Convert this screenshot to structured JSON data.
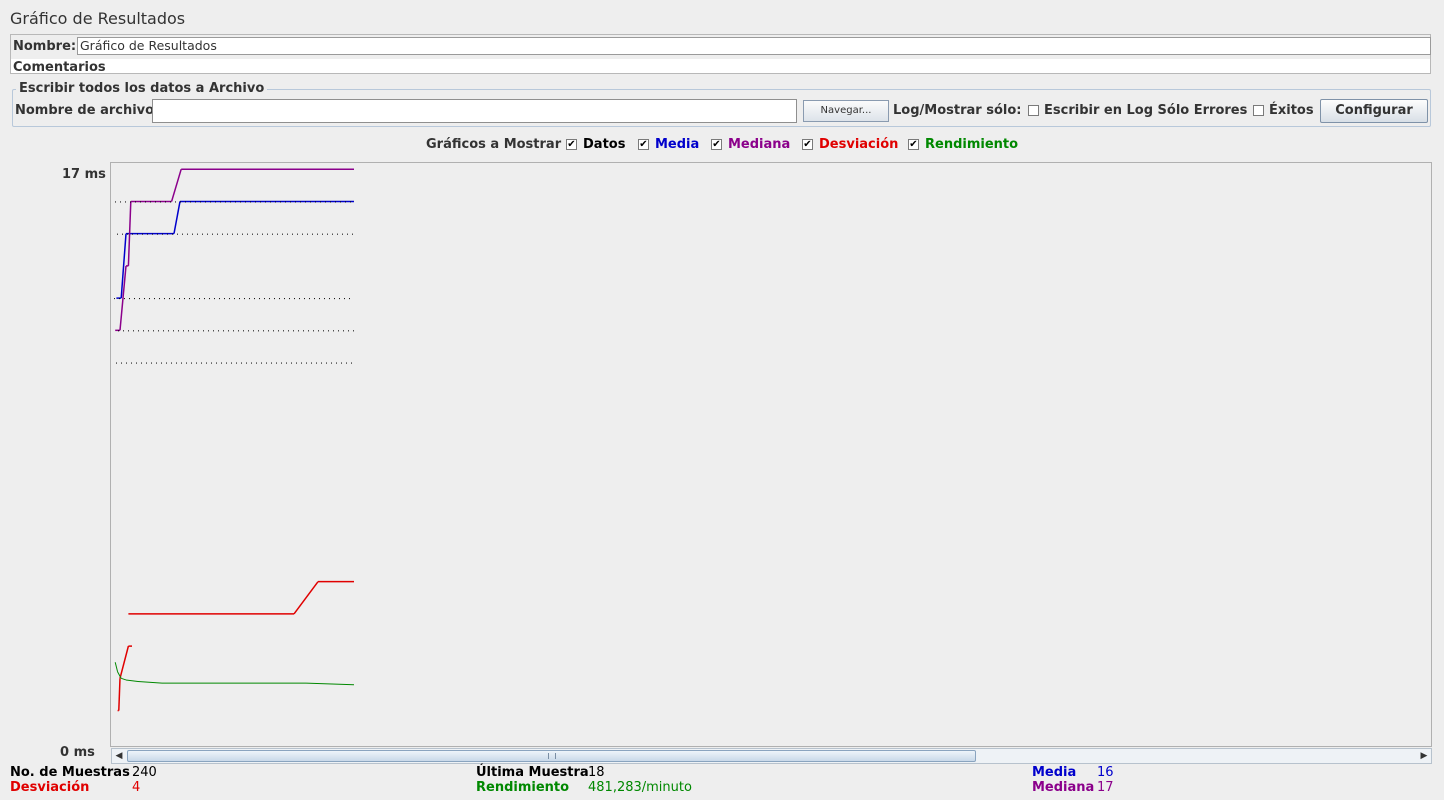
{
  "window": {
    "title": "Gráfico de Resultados"
  },
  "name_panel": {
    "name_label": "Nombre:",
    "name_value": "Gráfico de Resultados",
    "comments_label": "Comentarios"
  },
  "file_panel": {
    "group_title": "Escribir todos los datos a Archivo",
    "filename_label": "Nombre de archivo",
    "filename_value": "",
    "browse_label": "Navegar...",
    "log_show_label": "Log/Mostrar sólo:",
    "errors_only_label": "Escribir en Log Sólo Errores",
    "errors_only_checked": false,
    "successes_label": "Éxitos",
    "successes_checked": false,
    "configure_label": "Configurar"
  },
  "graph_options": {
    "label": "Gráficos a Mostrar",
    "items": [
      {
        "label": "Datos",
        "checked": true,
        "color": "#000000"
      },
      {
        "label": "Media",
        "checked": true,
        "color": "#0000cc"
      },
      {
        "label": "Mediana",
        "checked": true,
        "color": "#8b008b"
      },
      {
        "label": "Desviación",
        "checked": true,
        "color": "#e00000"
      },
      {
        "label": "Rendimiento",
        "checked": true,
        "color": "#008800"
      }
    ]
  },
  "chart_data": {
    "type": "line",
    "ylabel_top": "17 ms",
    "ylabel_bottom": "0 ms",
    "ylim": [
      0,
      17
    ],
    "grid": false,
    "x_label": "",
    "series": [
      {
        "name": "Media",
        "color": "#0000cc",
        "points": [
          [
            2,
            13.9
          ],
          [
            6,
            13.9
          ],
          [
            10,
            15.9
          ],
          [
            50,
            15.9
          ],
          [
            55,
            16.9
          ],
          [
            200,
            16.9
          ]
        ]
      },
      {
        "name": "Mediana",
        "color": "#8b008b",
        "points": [
          [
            1,
            12.9
          ],
          [
            5,
            12.9
          ],
          [
            10,
            14.9
          ],
          [
            12,
            14.9
          ],
          [
            14,
            16.9
          ],
          [
            48,
            16.9
          ],
          [
            56,
            17.9
          ],
          [
            200,
            17.9
          ]
        ]
      },
      {
        "name": "Desviación",
        "color": "#e00000",
        "points": [
          [
            3,
            1.1
          ],
          [
            4,
            1.1
          ],
          [
            5,
            2.1
          ],
          [
            12,
            3.1
          ],
          [
            15,
            3.1
          ],
          [
            12,
            4.1
          ],
          [
            30,
            4.1
          ],
          [
            40,
            4.1
          ],
          [
            75,
            4.1
          ],
          [
            110,
            4.1
          ],
          [
            150,
            4.1
          ],
          [
            170,
            5.1
          ],
          [
            200,
            5.1
          ]
        ]
      },
      {
        "name": "Rendimiento",
        "color": "#008800",
        "points": [
          [
            1,
            2.6
          ],
          [
            3,
            2.3
          ],
          [
            6,
            2.1
          ],
          [
            10,
            2.05
          ],
          [
            20,
            2.0
          ],
          [
            40,
            1.95
          ],
          [
            100,
            1.95
          ],
          [
            160,
            1.95
          ],
          [
            200,
            1.9
          ]
        ]
      }
    ],
    "samples_shown": 240
  },
  "stats": {
    "samples_label": "No. de Muestras",
    "samples_value": "240",
    "last_sample_label": "Última Muestra",
    "last_sample_value": "18",
    "average_label": "Media",
    "average_value": "16",
    "deviation_label": "Desviación",
    "deviation_value": "4",
    "throughput_label": "Rendimiento",
    "throughput_value": "481,283/minuto",
    "median_label": "Mediana",
    "median_value": "17"
  },
  "colors": {
    "data": "#000000",
    "average": "#0000cc",
    "median": "#8b008b",
    "deviation": "#e00000",
    "throughput": "#008800"
  }
}
